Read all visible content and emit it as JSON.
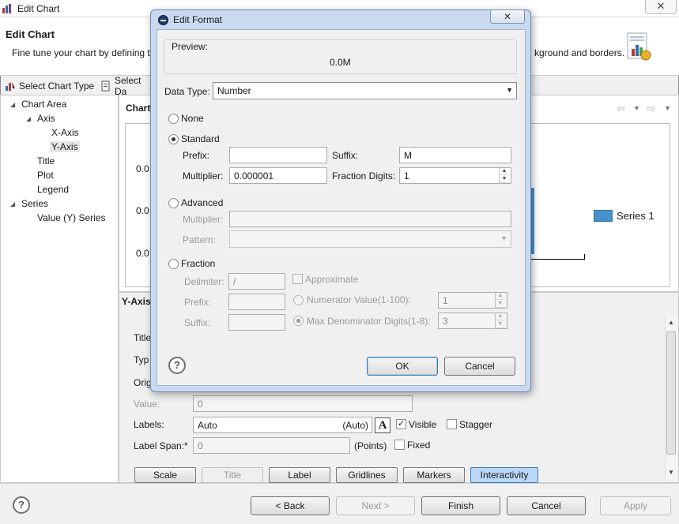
{
  "main": {
    "title": "Edit Chart",
    "close_glyph": "✕",
    "header_title": "Edit Chart",
    "header_desc_left": "Fine tune your chart by defining t",
    "header_desc_right": "kground and borders.",
    "header_icon": "chart-wizard-icon",
    "toolbar": {
      "select_chart_type": "Select Chart Type",
      "select_data": "Select Da"
    },
    "tree": {
      "chart_area": "Chart Area",
      "axis": "Axis",
      "x_axis": "X-Axis",
      "y_axis": "Y-Axis",
      "title": "Title",
      "plot": "Plot",
      "legend": "Legend",
      "series": "Series",
      "value_series": "Value (Y) Series"
    },
    "preview": {
      "chart_label": "Chart",
      "y_ticks": [
        "0.0",
        "0.0",
        "0.0"
      ],
      "legend_label": "Series 1",
      "series_color": "#4a90c8"
    },
    "settings": {
      "header": "Y-Axis",
      "title_label": "Title",
      "type_label": "Typ",
      "origin_label": "Orig",
      "value_label": "Value:",
      "value_field": "0",
      "labels_label": "Labels:",
      "labels_value": "Auto",
      "labels_auto": "(Auto)",
      "visible_label": "Visible",
      "visible_checked": true,
      "stagger_label": "Stagger",
      "stagger_checked": false,
      "label_span_label": "Label Span:*",
      "label_span_value": "0",
      "points_label": "(Points)",
      "fixed_label": "Fixed",
      "fixed_checked": false,
      "font_button": "A"
    },
    "tabs": {
      "scale": "Scale",
      "title": "Title",
      "label": "Label",
      "gridlines": "Gridlines",
      "markers": "Markers",
      "interactivity": "Interactivity"
    },
    "buttons": {
      "help": "?",
      "back": "< Back",
      "next": "Next >",
      "finish": "Finish",
      "cancel": "Cancel",
      "apply": "Apply"
    }
  },
  "dialog": {
    "title": "Edit Format",
    "close_glyph": "✕",
    "preview_label": "Preview:",
    "preview_value": "0.0M",
    "data_type_label": "Data Type:",
    "data_type_value": "Number",
    "none_label": "None",
    "standard_label": "Standard",
    "prefix_label": "Prefix:",
    "prefix_value": "",
    "suffix_label": "Suffix:",
    "suffix_value": "M",
    "multiplier_label": "Multiplier:",
    "multiplier_value": "0.000001",
    "fraction_digits_label": "Fraction Digits:",
    "fraction_digits_value": "1",
    "advanced_label": "Advanced",
    "adv_multiplier_label": "Multiplier:",
    "adv_pattern_label": "Pattern:",
    "fraction_label": "Fraction",
    "delimiter_label": "Delimiter:",
    "delimiter_value": "/",
    "approximate_label": "Approximate",
    "frac_prefix_label": "Prefix:",
    "frac_suffix_label": "Suffix:",
    "numerator_label": "Numerator Value(1-100):",
    "numerator_value": "1",
    "max_denom_label": "Max Denominator Digits(1-8):",
    "max_denom_value": "3",
    "help": "?",
    "ok": "OK",
    "cancel": "Cancel"
  }
}
